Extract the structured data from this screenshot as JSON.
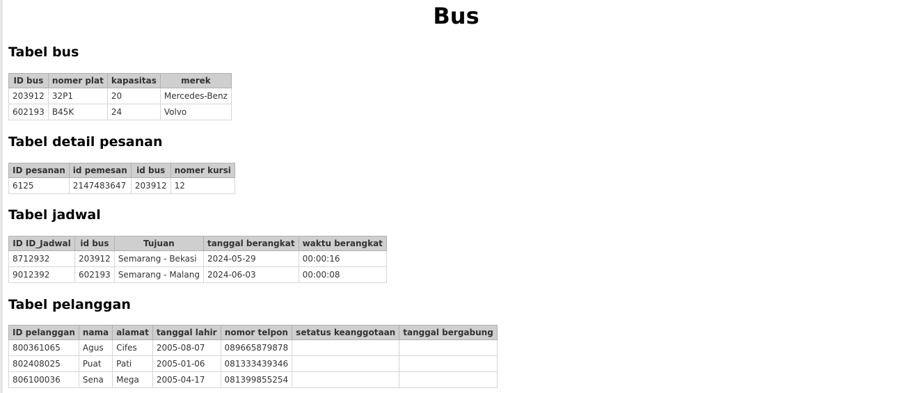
{
  "page": {
    "title": "Bus"
  },
  "sections": [
    {
      "title": "Tabel bus",
      "headers": [
        "ID bus",
        "nomer plat",
        "kapasitas",
        "merek"
      ],
      "rows": [
        [
          "203912",
          "32P1",
          "20",
          "Mercedes-Benz"
        ],
        [
          "602193",
          "B45K",
          "24",
          "Volvo"
        ]
      ]
    },
    {
      "title": "Tabel detail pesanan",
      "headers": [
        "ID pesanan",
        "id pemesan",
        "id bus",
        "nomer kursi"
      ],
      "rows": [
        [
          "6125",
          "2147483647",
          "203912",
          "12"
        ]
      ]
    },
    {
      "title": "Tabel jadwal",
      "headers": [
        "ID ID_Jadwal",
        "id bus",
        "Tujuan",
        "tanggal berangkat",
        "waktu berangkat"
      ],
      "rows": [
        [
          "8712932",
          "203912",
          "Semarang - Bekasi",
          "2024-05-29",
          "00:00:16"
        ],
        [
          "9012392",
          "602193",
          "Semarang - Malang",
          "2024-06-03",
          "00:00:08"
        ]
      ]
    },
    {
      "title": "Tabel pelanggan",
      "headers": [
        "ID pelanggan",
        "nama",
        "alamat",
        "tanggal lahir",
        "nomor telpon",
        "setatus keanggotaan",
        "tanggal bergabung"
      ],
      "rows": [
        [
          "800361065",
          "Agus",
          "Cifes",
          "2005-08-07",
          "089665879878",
          "",
          ""
        ],
        [
          "802408025",
          "Puat",
          "Pati",
          "2005-01-06",
          "081333439346",
          "",
          ""
        ],
        [
          "806100036",
          "Sena",
          "Mega",
          "2005-04-17",
          "081399855254",
          "",
          ""
        ]
      ]
    }
  ]
}
